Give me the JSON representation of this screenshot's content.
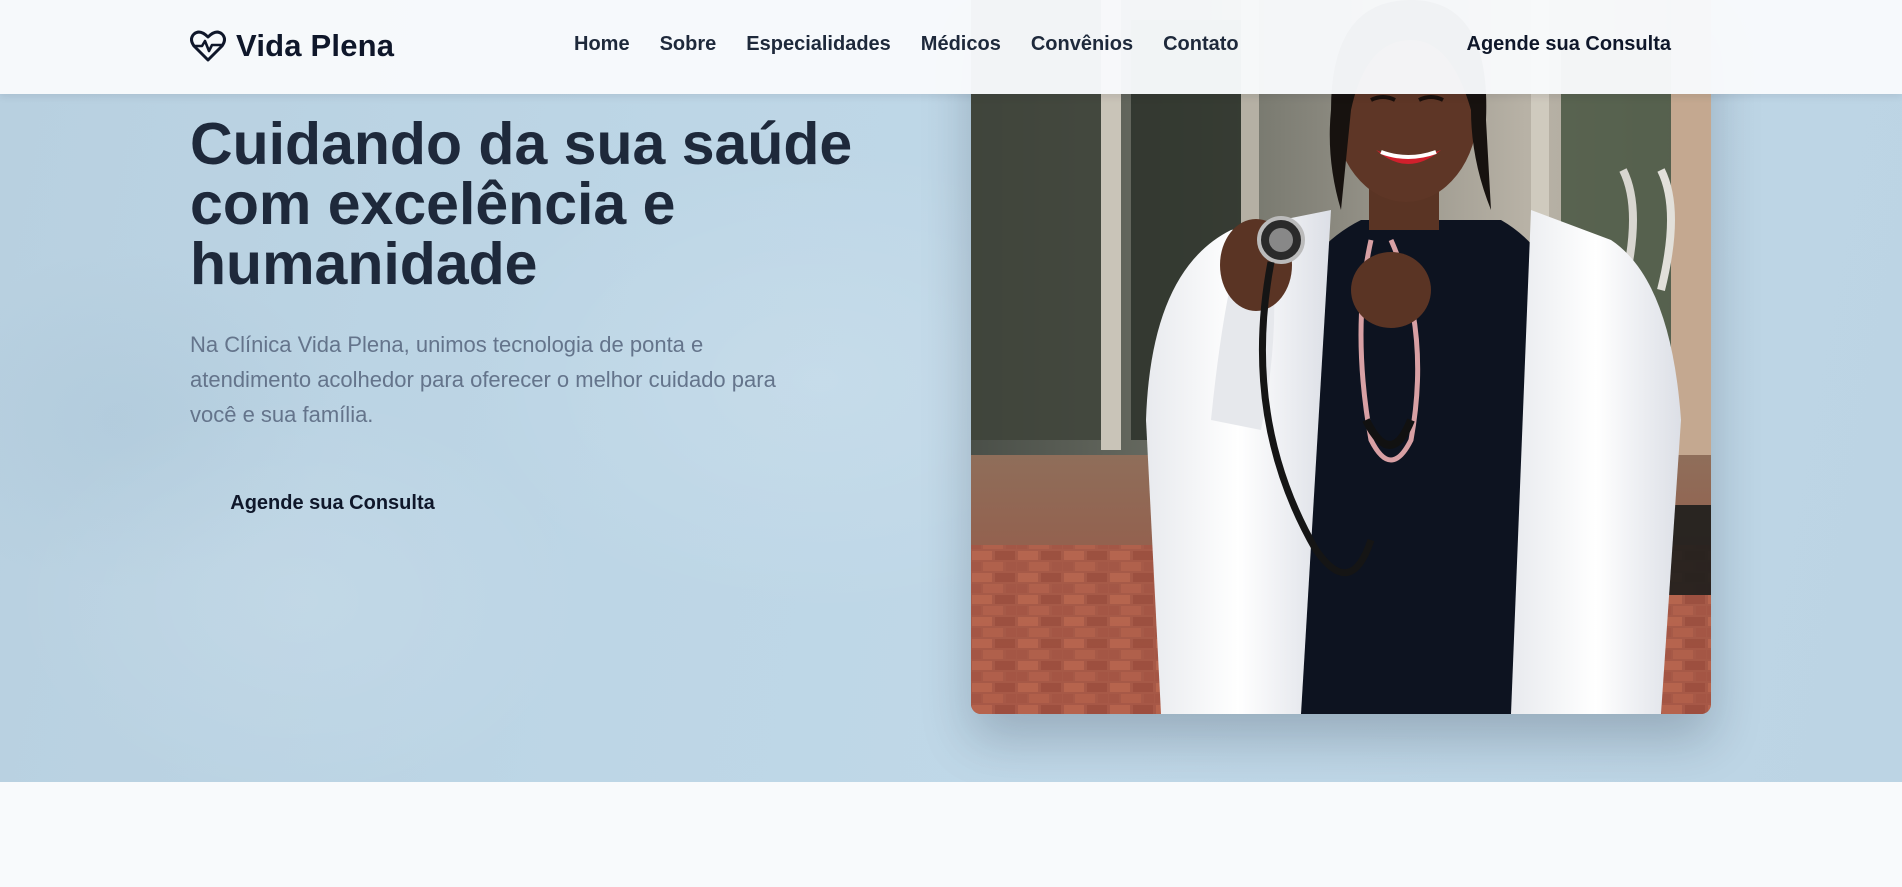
{
  "brand": {
    "name": "Vida Plena",
    "icon": "heart-pulse-icon"
  },
  "nav": {
    "items": [
      {
        "label": "Home"
      },
      {
        "label": "Sobre"
      },
      {
        "label": "Especialidades"
      },
      {
        "label": "Médicos"
      },
      {
        "label": "Convênios"
      },
      {
        "label": "Contato"
      }
    ],
    "cta_label": "Agende sua Consulta"
  },
  "hero": {
    "title": "Cuidando da sua saúde com excelência e humanidade",
    "description": "Na Clínica Vida Plena, unimos tecnologia de ponta e atendimento acolhedor para oferecer o melhor cuidado para você e sua família.",
    "cta_label": "Agende sua Consulta",
    "image": "doctor-with-stethoscope-photo"
  },
  "colors": {
    "text_primary": "#1e293b",
    "text_muted": "#64748b",
    "hero_bg": "#bdd6e6",
    "page_bg": "#f8fafc"
  }
}
